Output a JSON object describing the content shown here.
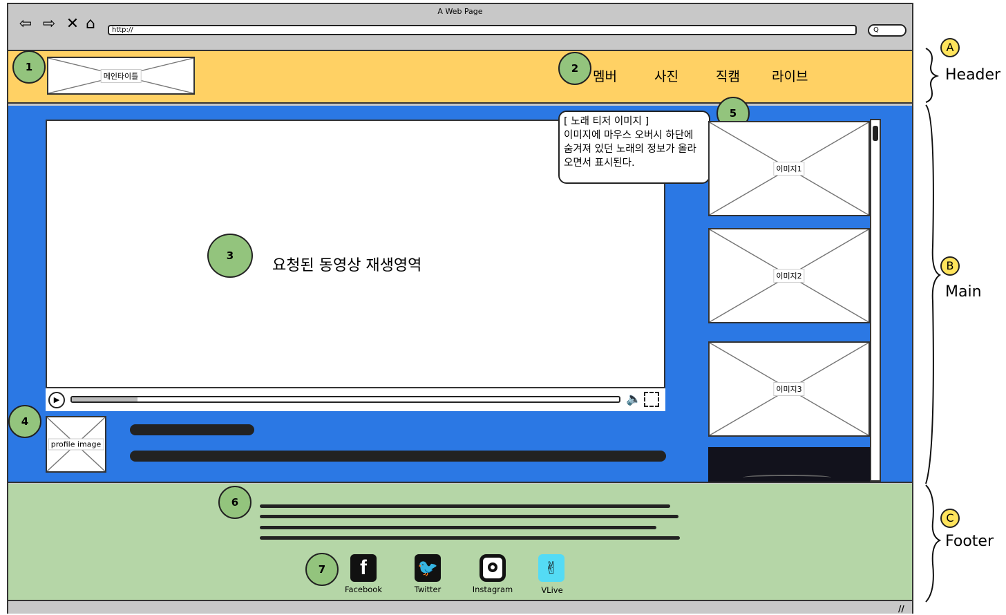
{
  "browser": {
    "title": "A Web Page",
    "url": "http://",
    "search_text": "Q"
  },
  "header": {
    "logo_label": "메인타이틀",
    "nav": [
      "멤버",
      "사진",
      "직캠",
      "라이브"
    ]
  },
  "main": {
    "video_caption": "요청된 동영상 재생영역",
    "tooltip": {
      "title": "[ 노래 티저 이미지 ]",
      "body": "이미지에 마우스 오버시 하단에 숨겨져 있던 노래의 정보가 올라오면서 표시된다."
    },
    "images": [
      "이미지1",
      "이미지2",
      "이미지3"
    ],
    "profile_label": "profile image"
  },
  "footer": {
    "social": [
      {
        "name": "Facebook",
        "icon": "facebook-icon",
        "color": "#111111"
      },
      {
        "name": "Twitter",
        "icon": "twitter-icon",
        "color": "#111111"
      },
      {
        "name": "Instagram",
        "icon": "instagram-icon",
        "color": "#111111"
      },
      {
        "name": "VLive",
        "icon": "vlive-icon",
        "color": "#54dbf5"
      }
    ]
  },
  "markers": [
    "1",
    "2",
    "3",
    "4",
    "5",
    "6",
    "7"
  ],
  "side_labels": {
    "a_letter": "A",
    "a_text": "Header",
    "b_letter": "B",
    "b_text": "Main",
    "c_letter": "C",
    "c_text": "Footer"
  },
  "colors": {
    "header": "#ffd164",
    "main": "#2b78e4",
    "footer": "#b5d6a7",
    "marker": "#93c47d"
  }
}
